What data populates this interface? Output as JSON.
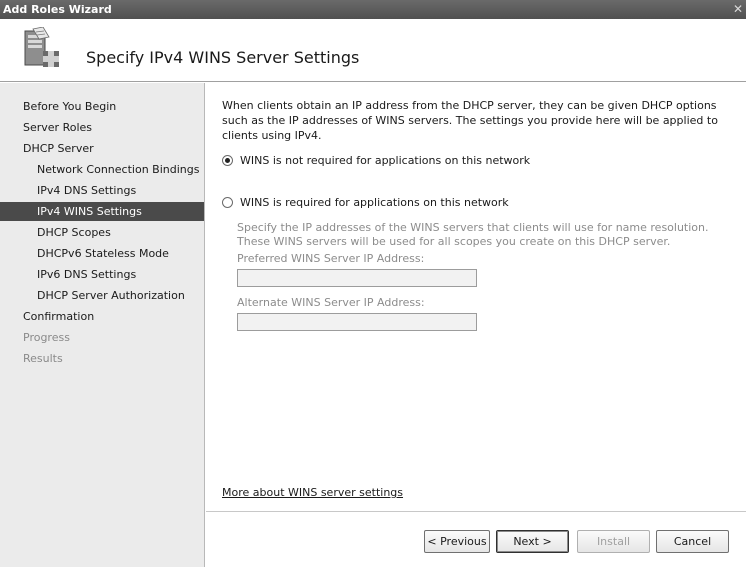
{
  "window": {
    "title": "Add Roles Wizard",
    "close_glyph": "✕"
  },
  "header": {
    "title": "Specify IPv4 WINS Server Settings",
    "icon": "server-roles-icon"
  },
  "nav": {
    "items": [
      {
        "label": "Before You Begin",
        "level": 0,
        "state": "normal"
      },
      {
        "label": "Server Roles",
        "level": 0,
        "state": "normal"
      },
      {
        "label": "DHCP Server",
        "level": 0,
        "state": "normal"
      },
      {
        "label": "Network Connection Bindings",
        "level": 1,
        "state": "normal"
      },
      {
        "label": "IPv4 DNS Settings",
        "level": 1,
        "state": "normal"
      },
      {
        "label": "IPv4 WINS Settings",
        "level": 1,
        "state": "selected"
      },
      {
        "label": "DHCP Scopes",
        "level": 1,
        "state": "normal"
      },
      {
        "label": "DHCPv6 Stateless Mode",
        "level": 1,
        "state": "normal"
      },
      {
        "label": "IPv6 DNS Settings",
        "level": 1,
        "state": "normal"
      },
      {
        "label": "DHCP Server Authorization",
        "level": 1,
        "state": "normal"
      },
      {
        "label": "Confirmation",
        "level": 0,
        "state": "normal"
      },
      {
        "label": "Progress",
        "level": 0,
        "state": "disabled"
      },
      {
        "label": "Results",
        "level": 0,
        "state": "disabled"
      }
    ]
  },
  "content": {
    "intro": "When clients obtain an IP address from the DHCP server, they can be given DHCP options such as the IP addresses of WINS servers. The settings you provide here will be applied to clients using IPv4.",
    "option_not_required": {
      "label": "WINS is not required for applications on this network",
      "checked": true
    },
    "option_required": {
      "label": "WINS is required for applications on this network",
      "checked": false
    },
    "required_description": "Specify the IP addresses of the WINS servers that clients will use for name resolution. These WINS servers will be used for all scopes you create on this DHCP server.",
    "preferred_label": "Preferred WINS Server IP Address:",
    "preferred_value": "",
    "alternate_label": "Alternate WINS Server IP Address:",
    "alternate_value": "",
    "help_link": "More about WINS server settings"
  },
  "buttons": {
    "previous": "< Previous",
    "next": "Next >",
    "install": "Install",
    "cancel": "Cancel"
  }
}
